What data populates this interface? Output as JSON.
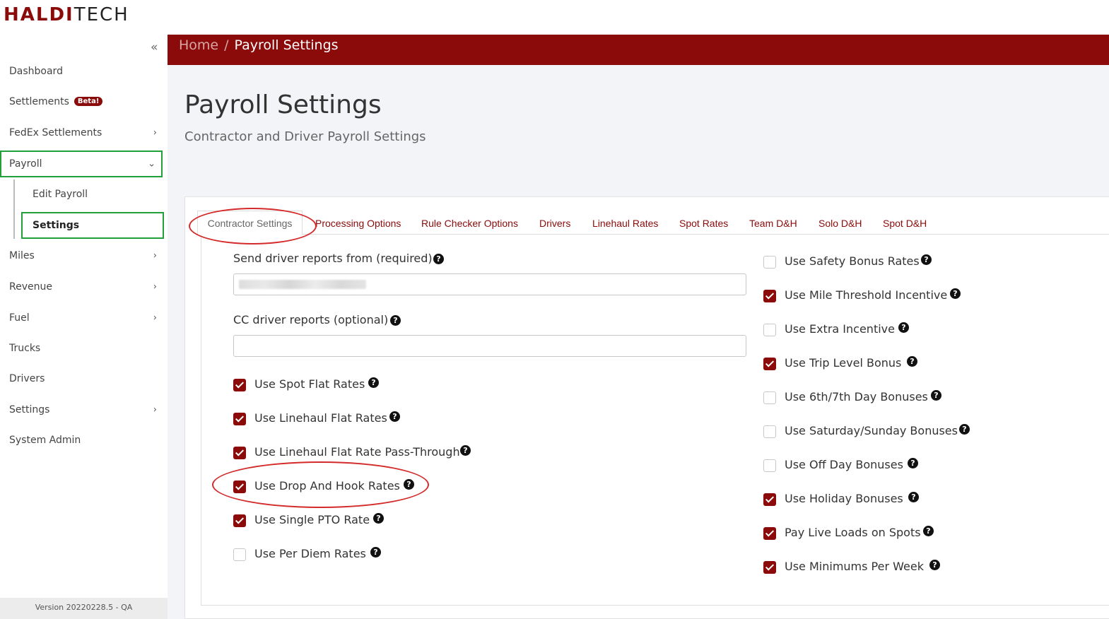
{
  "logo": {
    "part1": "HALDI",
    "part2": "TECH"
  },
  "sidebar": {
    "collapse_icon": "«",
    "items": [
      {
        "label": "Dashboard"
      },
      {
        "label": "Settlements",
        "badge": "Beta!"
      },
      {
        "label": "FedEx Settlements"
      },
      {
        "label": "Payroll"
      },
      {
        "label": "Edit Payroll"
      },
      {
        "label": "Settings"
      },
      {
        "label": "Miles"
      },
      {
        "label": "Revenue"
      },
      {
        "label": "Fuel"
      },
      {
        "label": "Trucks"
      },
      {
        "label": "Drivers"
      },
      {
        "label": "Settings"
      },
      {
        "label": "System Admin"
      }
    ],
    "version": "Version 20220228.5 - QA"
  },
  "breadcrumb": {
    "home": "Home",
    "separator": "/",
    "current": "Payroll Settings"
  },
  "page": {
    "title": "Payroll Settings",
    "subtitle": "Contractor and Driver Payroll Settings"
  },
  "tabs": [
    "Contractor Settings",
    "Processing Options",
    "Rule Checker Options",
    "Drivers",
    "Linehaul Rates",
    "Spot Rates",
    "Team D&H",
    "Solo D&H",
    "Spot D&H"
  ],
  "form": {
    "send_reports_label": "Send driver reports from (required)",
    "send_reports_value": "",
    "cc_reports_label": "CC driver reports (optional)",
    "cc_reports_value": ""
  },
  "left_options": [
    {
      "label": "Use Spot Flat Rates",
      "checked": true
    },
    {
      "label": "Use Linehaul Flat Rates",
      "checked": true
    },
    {
      "label": "Use Linehaul Flat Rate Pass-Through",
      "checked": true
    },
    {
      "label": "Use Drop And Hook Rates",
      "checked": true
    },
    {
      "label": "Use Single PTO Rate",
      "checked": true
    },
    {
      "label": "Use Per Diem Rates",
      "checked": false
    }
  ],
  "right_options": [
    {
      "label": "Use Safety Bonus Rates",
      "checked": false
    },
    {
      "label": "Use Mile Threshold Incentive",
      "checked": true
    },
    {
      "label": "Use Extra Incentive",
      "checked": false
    },
    {
      "label": "Use Trip Level Bonus",
      "checked": true
    },
    {
      "label": "Use 6th/7th Day Bonuses",
      "checked": false
    },
    {
      "label": "Use Saturday/Sunday Bonuses",
      "checked": false
    },
    {
      "label": "Use Off Day Bonuses",
      "checked": false
    },
    {
      "label": "Use Holiday Bonuses",
      "checked": true
    },
    {
      "label": "Pay Live Loads on Spots",
      "checked": true
    },
    {
      "label": "Use Minimums Per Week",
      "checked": true
    }
  ],
  "help_glyph": "?",
  "colors": {
    "brand": "#8b0a0a",
    "highlight_box": "#22a03a",
    "annotation_ring": "#d42a2a"
  }
}
